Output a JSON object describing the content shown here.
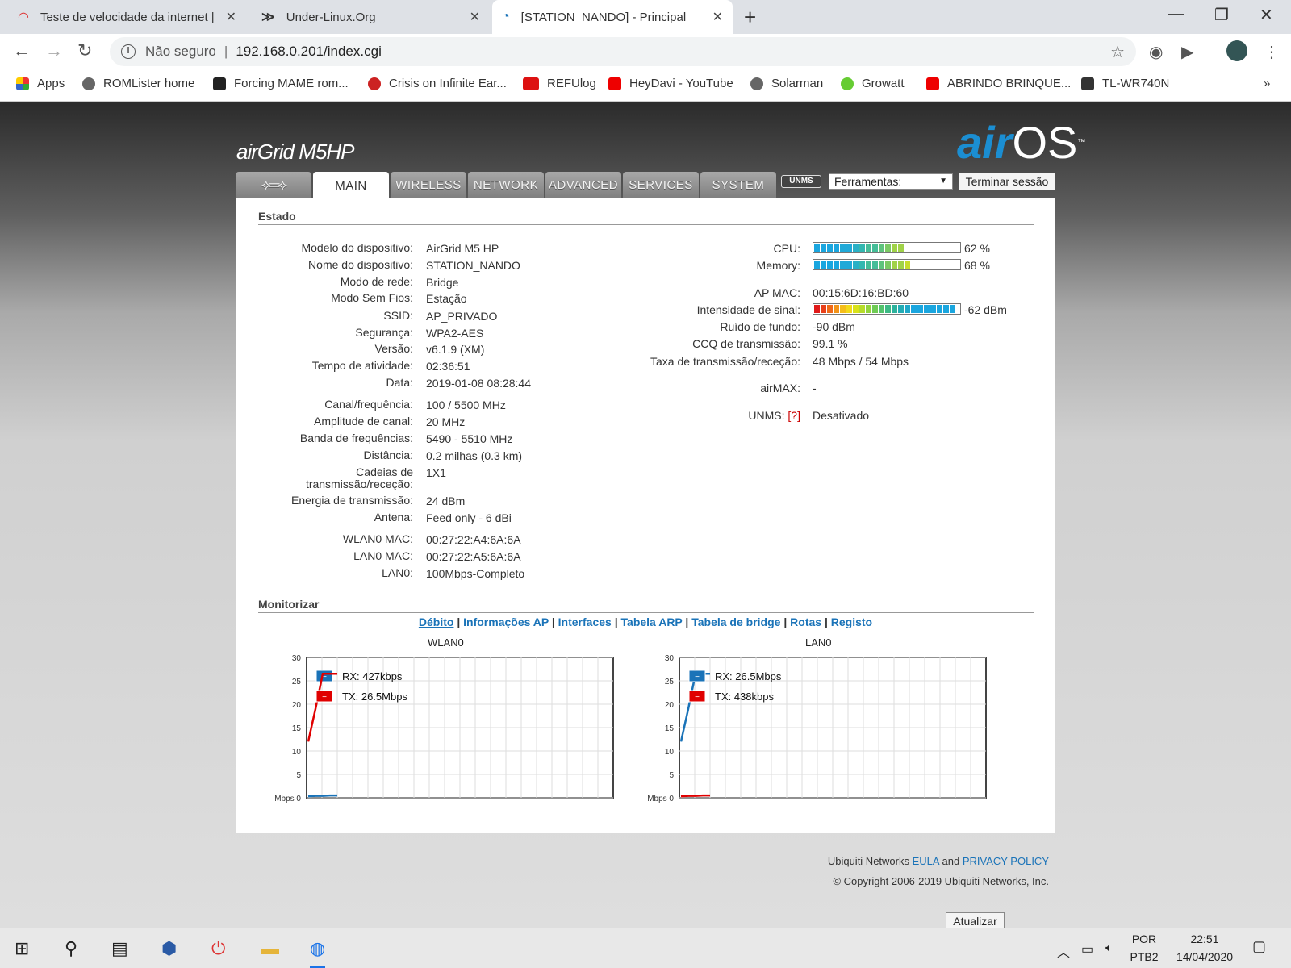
{
  "browser": {
    "tabs": [
      {
        "title": "Teste de velocidade da internet |",
        "active": false
      },
      {
        "title": "Under-Linux.Org",
        "active": false
      },
      {
        "title": "[STATION_NANDO] - Principal",
        "active": true
      }
    ],
    "address": {
      "security": "Não seguro",
      "url": "192.168.0.201/index.cgi"
    },
    "bookmarks": [
      "Apps",
      "ROMLister home",
      "Forcing MAME rom...",
      "Crisis on Infinite Ear...",
      "REFUlog",
      "HeyDavi - YouTube",
      "Solarman",
      "Growatt",
      "ABRINDO BRINQUE...",
      "TL-WR740N"
    ],
    "overflow": "»"
  },
  "header": {
    "product_logo": "airGrid M5HP",
    "os_logo_air": "air",
    "os_logo_os": "OS",
    "os_logo_tm": "™"
  },
  "nav": {
    "tabs": [
      "MAIN",
      "WIRELESS",
      "NETWORK",
      "ADVANCED",
      "SERVICES",
      "SYSTEM"
    ],
    "active": "MAIN",
    "unms": "UNMS",
    "tools_label": "Ferramentas:",
    "logout": "Terminar sessão"
  },
  "status": {
    "title": "Estado",
    "left": [
      {
        "label": "Modelo do dispositivo:",
        "value": "AirGrid M5 HP"
      },
      {
        "label": "Nome do dispositivo:",
        "value": "STATION_NANDO"
      },
      {
        "label": "Modo de rede:",
        "value": "Bridge"
      },
      {
        "label": "Modo Sem Fios:",
        "value": "Estação"
      },
      {
        "label": "SSID:",
        "value": "AP_PRIVADO"
      },
      {
        "label": "Segurança:",
        "value": "WPA2-AES"
      },
      {
        "label": "Versão:",
        "value": "v6.1.9 (XM)"
      },
      {
        "label": "Tempo de atividade:",
        "value": "02:36:51"
      },
      {
        "label": "Data:",
        "value": "2019-01-08 08:28:44"
      },
      {
        "label": "Canal/frequência:",
        "value": "100 / 5500 MHz"
      },
      {
        "label": "Amplitude de canal:",
        "value": "20 MHz"
      },
      {
        "label": "Banda de frequências:",
        "value": "5490 - 5510 MHz"
      },
      {
        "label": "Distância:",
        "value": "0.2 milhas (0.3 km)"
      },
      {
        "label": "Cadeias de",
        "label2": "transmissão/receção:",
        "value": "1X1"
      },
      {
        "label": "Energia de transmissão:",
        "value": "24 dBm"
      },
      {
        "label": "Antena:",
        "value": "Feed only - 6 dBi"
      },
      {
        "label": "WLAN0 MAC:",
        "value": "00:27:22:A4:6A:6A"
      },
      {
        "label": "LAN0 MAC:",
        "value": "00:27:22:A5:6A:6A"
      },
      {
        "label": "LAN0:",
        "value": "100Mbps-Completo"
      }
    ],
    "cpu": {
      "label": "CPU:",
      "value": "62 %",
      "level": 0.62
    },
    "memory": {
      "label": "Memory:",
      "value": "68 %",
      "level": 0.68
    },
    "ap_mac": {
      "label": "AP MAC:",
      "value": "00:15:6D:16:BD:60"
    },
    "signal": {
      "label": "Intensidade de sinal:",
      "value": "-62 dBm",
      "level": 1.0
    },
    "noise": {
      "label": "Ruído de fundo:",
      "value": "-90 dBm"
    },
    "ccq": {
      "label": "CCQ de transmissão:",
      "value": "99.1 %"
    },
    "rate": {
      "label": "Taxa de transmissão/receção:",
      "value": "48 Mbps / 54 Mbps"
    },
    "airmax": {
      "label": "airMAX:",
      "value": "-"
    },
    "unms": {
      "label": "UNMS:",
      "help": "[?]",
      "value": "Desativado"
    }
  },
  "monitor": {
    "title": "Monitorizar",
    "links": [
      "Débito",
      "Informações AP",
      "Interfaces",
      "Tabela ARP",
      "Tabela de bridge",
      "Rotas",
      "Registo"
    ],
    "refresh": "Atualizar"
  },
  "chart_data": [
    {
      "type": "line",
      "title": "WLAN0",
      "ylabel": "Mbps",
      "ylim": [
        0,
        30
      ],
      "yticks": [
        0,
        5,
        10,
        15,
        20,
        25,
        30
      ],
      "grid": true,
      "legend": "top-left",
      "series": [
        {
          "name": "RX: 427kbps",
          "color": "#1a73b8",
          "values": [
            0.3,
            0.4,
            0.4,
            0.5,
            0.5
          ]
        },
        {
          "name": "TX: 26.5Mbps",
          "color": "#e00000",
          "values": [
            12,
            19,
            26.5,
            26.5,
            26.5
          ]
        }
      ]
    },
    {
      "type": "line",
      "title": "LAN0",
      "ylabel": "Mbps",
      "ylim": [
        0,
        30
      ],
      "yticks": [
        0,
        5,
        10,
        15,
        20,
        25,
        30
      ],
      "grid": true,
      "legend": "top-left",
      "series": [
        {
          "name": "RX: 26.5Mbps",
          "color": "#1a73b8",
          "values": [
            12,
            19,
            26.5,
            26.5,
            26.5
          ]
        },
        {
          "name": "TX: 438kbps",
          "color": "#e00000",
          "values": [
            0.3,
            0.4,
            0.4,
            0.5,
            0.5
          ]
        }
      ]
    }
  ],
  "footer": {
    "line1_prefix": "Ubiquiti Networks",
    "eula": "EULA",
    "and": "and",
    "privacy": "PRIVACY POLICY",
    "copyright": "© Copyright 2006-2019 Ubiquiti Networks, Inc."
  },
  "taskbar": {
    "lang1": "POR",
    "lang2": "PTB2",
    "time": "22:51",
    "date": "14/04/2020"
  }
}
